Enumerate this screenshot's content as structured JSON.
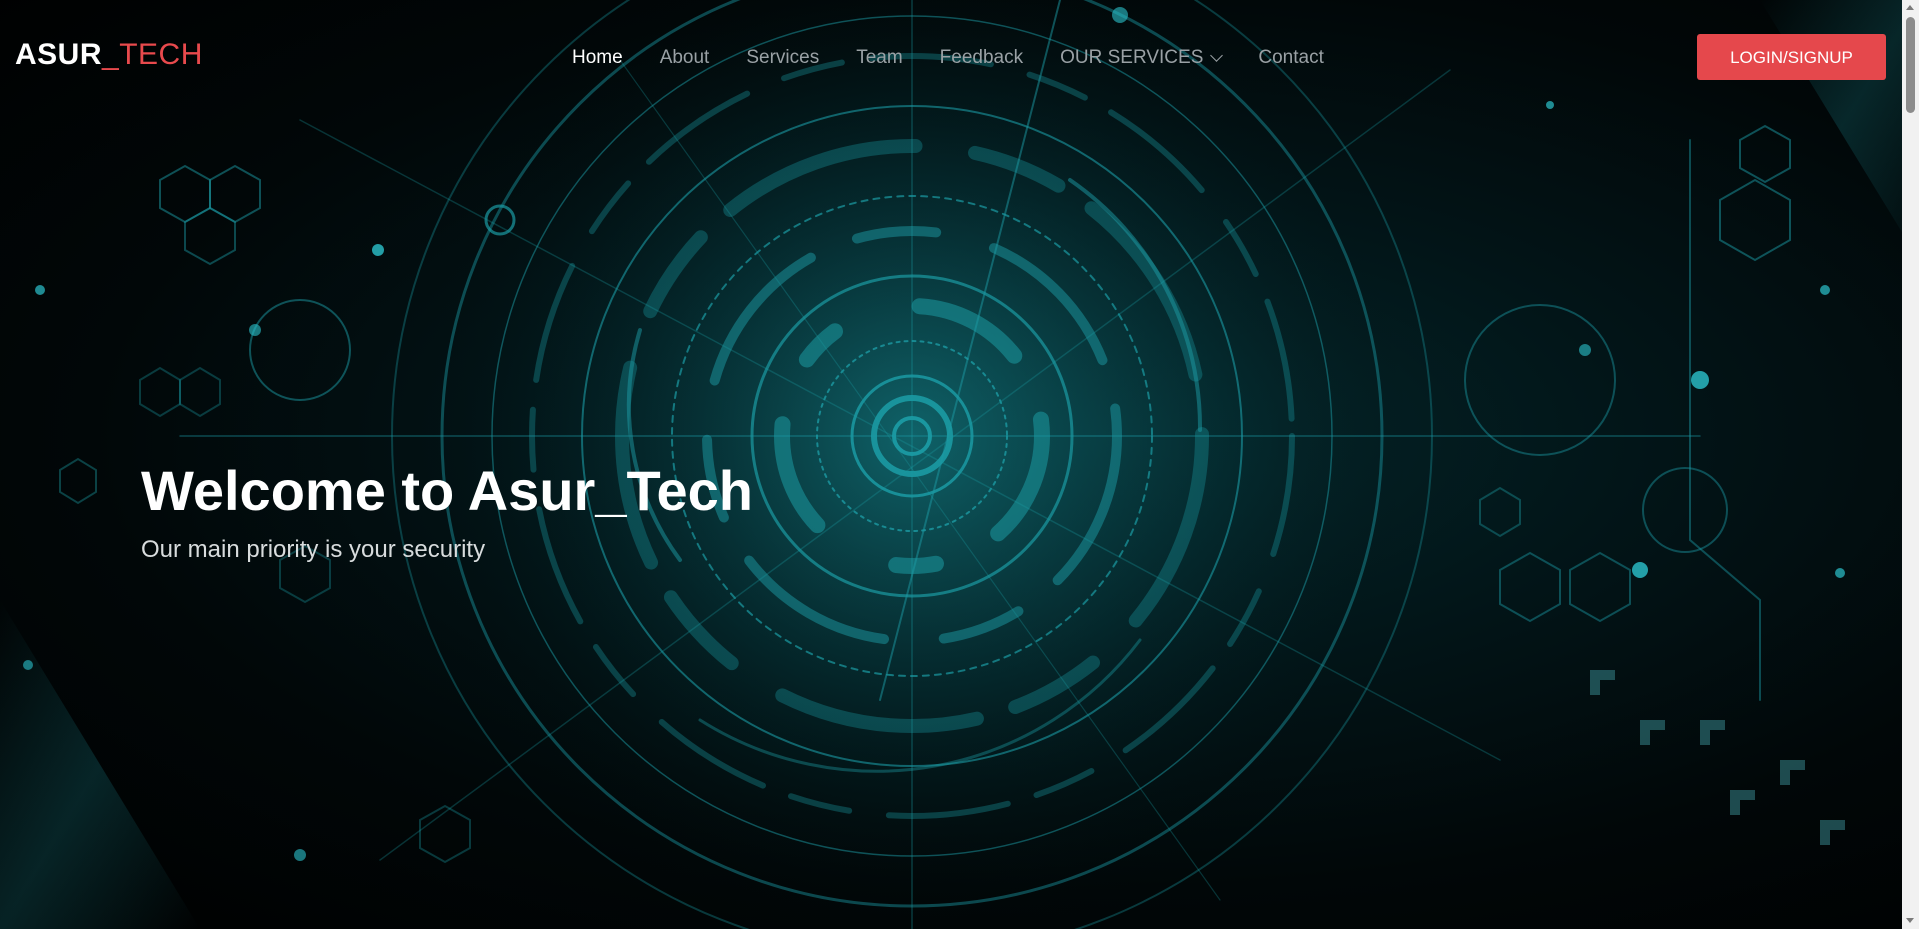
{
  "brand": {
    "name_main": "ASUR",
    "name_accent": "_TECH",
    "accent_color": "#e84a4d"
  },
  "nav": {
    "items": [
      {
        "label": "Home",
        "active": true
      },
      {
        "label": "About"
      },
      {
        "label": "Services"
      },
      {
        "label": "Team"
      },
      {
        "label": "Feedback"
      },
      {
        "label": "OUR SERVICES",
        "dropdown": true,
        "icon": "chevron-down-icon"
      },
      {
        "label": "Contact"
      }
    ]
  },
  "header": {
    "login_label": "LOGIN/SIGNUP",
    "login_color": "#e5484c"
  },
  "hero": {
    "title": "Welcome to Asur_Tech",
    "subtitle": "Our main priority is your security",
    "background": "cyber-tech-circle-illustration",
    "theme_color": "#1fa3ad"
  }
}
